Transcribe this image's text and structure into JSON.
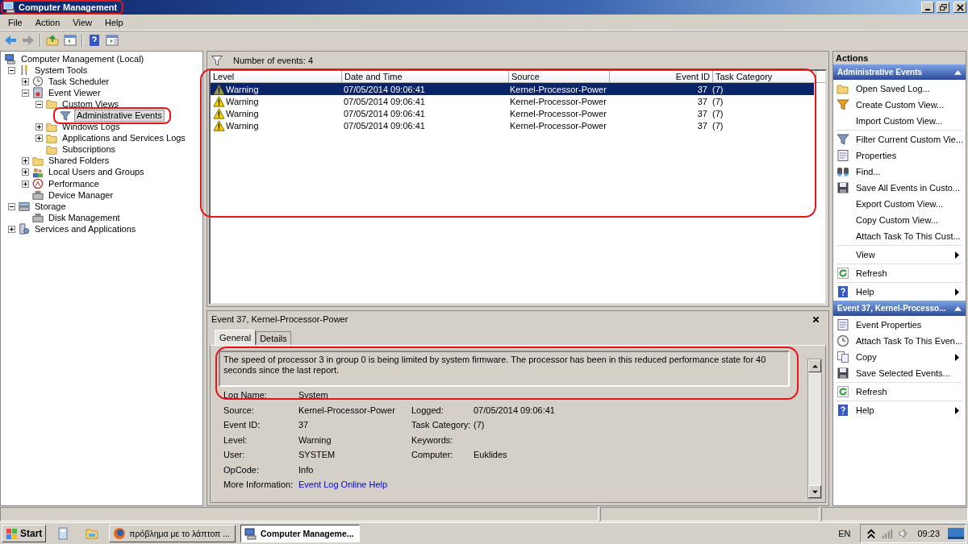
{
  "window": {
    "title": "Computer Management"
  },
  "menu": [
    "File",
    "Action",
    "View",
    "Help"
  ],
  "tree": [
    {
      "label": "Computer Management (Local)",
      "kind": "root",
      "selected": false,
      "children": [
        {
          "label": "System Tools",
          "kind": "branch",
          "expanded": true,
          "selected": false,
          "children": [
            {
              "label": "Task Scheduler",
              "kind": "branch",
              "expanded": false,
              "selected": false
            },
            {
              "label": "Event Viewer",
              "kind": "branch",
              "expanded": true,
              "selected": false,
              "children": [
                {
                  "label": "Custom Views",
                  "kind": "branch",
                  "expanded": true,
                  "selected": false,
                  "children": [
                    {
                      "label": "Administrative Events",
                      "kind": "leaf",
                      "selected": true
                    }
                  ]
                },
                {
                  "label": "Windows Logs",
                  "kind": "branch",
                  "expanded": false,
                  "selected": false
                },
                {
                  "label": "Applications and Services Logs",
                  "kind": "branch",
                  "expanded": false,
                  "selected": false
                },
                {
                  "label": "Subscriptions",
                  "kind": "leaf",
                  "selected": false
                }
              ]
            },
            {
              "label": "Shared Folders",
              "kind": "branch",
              "expanded": false,
              "selected": false
            },
            {
              "label": "Local Users and Groups",
              "kind": "branch",
              "expanded": false,
              "selected": false
            },
            {
              "label": "Performance",
              "kind": "branch",
              "expanded": false,
              "selected": false
            },
            {
              "label": "Device Manager",
              "kind": "leaf",
              "selected": false
            }
          ]
        },
        {
          "label": "Storage",
          "kind": "branch",
          "expanded": true,
          "selected": false,
          "children": [
            {
              "label": "Disk Management",
              "kind": "leaf",
              "selected": false
            }
          ]
        },
        {
          "label": "Services and Applications",
          "kind": "branch",
          "expanded": false,
          "selected": false
        }
      ]
    }
  ],
  "events": {
    "count_label": "Number of events: 4",
    "columns": [
      {
        "label": "Level"
      },
      {
        "label": "Date and Time"
      },
      {
        "label": "Source"
      },
      {
        "label": "Event ID"
      },
      {
        "label": "Task Category"
      }
    ],
    "rows": [
      {
        "cells": [
          "Warning",
          "07/05/2014 09:06:41",
          "Kernel-Processor-Power",
          "37",
          "(7)"
        ],
        "selected": true
      },
      {
        "cells": [
          "Warning",
          "07/05/2014 09:06:41",
          "Kernel-Processor-Power",
          "37",
          "(7)"
        ],
        "selected": false
      },
      {
        "cells": [
          "Warning",
          "07/05/2014 09:06:41",
          "Kernel-Processor-Power",
          "37",
          "(7)"
        ],
        "selected": false
      },
      {
        "cells": [
          "Warning",
          "07/05/2014 09:06:41",
          "Kernel-Processor-Power",
          "37",
          "(7)"
        ],
        "selected": false
      }
    ]
  },
  "detail": {
    "title": "Event 37, Kernel-Processor-Power",
    "tabs": [
      {
        "label": "General",
        "selected": true
      },
      {
        "label": "Details",
        "selected": false
      }
    ],
    "description": "The speed of processor 3 in group 0 is being limited by system firmware. The processor has been in this reduced performance state for 40 seconds since the last report.",
    "rows": [
      [
        {
          "label": "Log Name:",
          "value": "System",
          "kind": "text"
        }
      ],
      [
        {
          "label": "Source:",
          "value": "Kernel-Processor-Power",
          "kind": "text"
        },
        {
          "label": "Logged:",
          "value": "07/05/2014 09:06:41",
          "kind": "text"
        }
      ],
      [
        {
          "label": "Event ID:",
          "value": "37",
          "kind": "text"
        },
        {
          "label": "Task Category:",
          "value": "(7)",
          "kind": "text"
        }
      ],
      [
        {
          "label": "Level:",
          "value": "Warning",
          "kind": "text"
        },
        {
          "label": "Keywords:",
          "kind": "text"
        }
      ],
      [
        {
          "label": "User:",
          "value": "SYSTEM",
          "kind": "text"
        },
        {
          "label": "Computer:",
          "value": "Euklides",
          "kind": "text"
        }
      ],
      [
        {
          "label": "OpCode:",
          "value": "Info",
          "kind": "text"
        }
      ],
      [
        {
          "label": "More Information:",
          "value": "Event Log Online Help",
          "kind": "link"
        }
      ]
    ]
  },
  "actions": {
    "title": "Actions",
    "sections": [
      {
        "title": "Administrative Events",
        "expanded": true,
        "groups": [
          [
            {
              "label": "Open Saved Log...",
              "submenu": false
            },
            {
              "label": "Create Custom View...",
              "submenu": false
            },
            {
              "label": "Import Custom View...",
              "submenu": false
            }
          ],
          [
            {
              "label": "Filter Current Custom Vie...",
              "submenu": false
            },
            {
              "label": "Properties",
              "submenu": false
            },
            {
              "label": "Find...",
              "submenu": false
            },
            {
              "label": "Save All Events in Custo...",
              "submenu": false
            },
            {
              "label": "Export Custom View...",
              "submenu": false
            },
            {
              "label": "Copy Custom View...",
              "submenu": false
            },
            {
              "label": "Attach Task To This Cust...",
              "submenu": false
            }
          ],
          [
            {
              "label": "View",
              "submenu": true
            }
          ],
          [
            {
              "label": "Refresh",
              "submenu": false
            }
          ],
          [
            {
              "label": "Help",
              "submenu": true
            }
          ]
        ]
      },
      {
        "title": "Event 37, Kernel-Processo...",
        "expanded": true,
        "groups": [
          [
            {
              "label": "Event Properties",
              "submenu": false
            },
            {
              "label": "Attach Task To This Even...",
              "submenu": false
            },
            {
              "label": "Copy",
              "submenu": true
            },
            {
              "label": "Save Selected Events...",
              "submenu": false
            }
          ],
          [
            {
              "label": "Refresh",
              "submenu": false
            }
          ],
          [
            {
              "label": "Help",
              "submenu": true
            }
          ]
        ]
      }
    ]
  },
  "taskbar": {
    "start": "Start",
    "tasks": [
      {
        "label": "πρόβλημα με το λάπτοπ ...",
        "selected": false
      },
      {
        "label": "Computer Manageme...",
        "selected": true
      }
    ],
    "language": "EN",
    "time": "09:23"
  }
}
